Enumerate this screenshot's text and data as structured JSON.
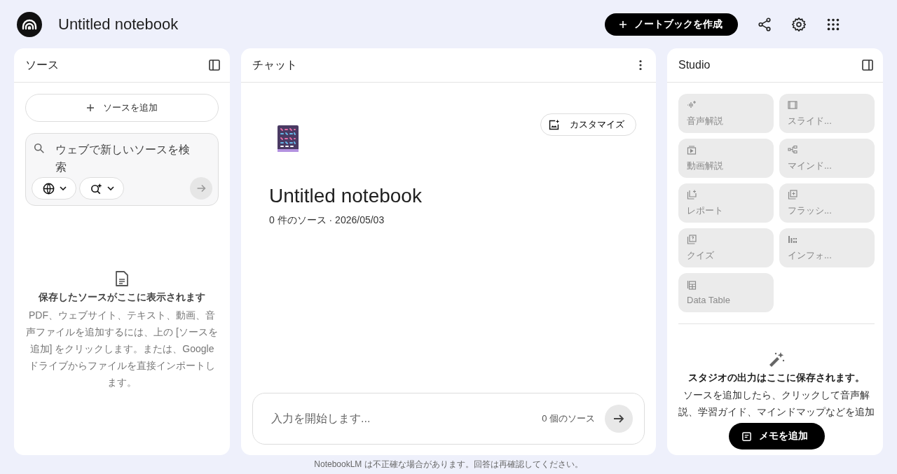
{
  "header": {
    "title": "Untitled notebook",
    "create_button": "ノートブックを作成"
  },
  "sources": {
    "title": "ソース",
    "add_button": "ソースを追加",
    "search": {
      "placeholder": "ウェブで新しいソースを検索"
    },
    "empty_title": "保存したソースがここに表示されます",
    "empty_text": "PDF、ウェブサイト、テキスト、動画、音声ファイルを追加するには、上の [ソースを追加] をクリックします。または、Google ドライブからファイルを直接インポートします。"
  },
  "chat": {
    "title": "チャット",
    "customize_button": "カスタマイズ",
    "notebook_title": "Untitled notebook",
    "meta": "0 件のソース · 2026/05/03",
    "input": {
      "placeholder": "入力を開始します..."
    },
    "source_count": "0 個のソース"
  },
  "studio": {
    "title": "Studio",
    "tiles": [
      {
        "kind": "audio",
        "label": "音声解説",
        "disabled": true
      },
      {
        "kind": "slides",
        "label": "スライド...",
        "disabled": true
      },
      {
        "kind": "video",
        "label": "動画解説",
        "disabled": true
      },
      {
        "kind": "mindmap",
        "label": "マインド...",
        "disabled": true
      },
      {
        "kind": "report",
        "label": "レポート",
        "disabled": true
      },
      {
        "kind": "flashcards",
        "label": "フラッシ...",
        "disabled": true
      },
      {
        "kind": "quiz",
        "label": "クイズ",
        "disabled": true
      },
      {
        "kind": "infographic",
        "label": "インフォ...",
        "disabled": true
      },
      {
        "kind": "table",
        "label": "Data Table",
        "disabled": true
      }
    ],
    "empty_title": "スタジオの出力はここに保存されます。",
    "empty_text": "ソースを追加したら、クリックして音声解説、学習ガイド、マインドマップなどを追加",
    "note_button": "メモを追加"
  },
  "footer": "NotebookLM は不正確な場合があります。回答は再確認してください。"
}
